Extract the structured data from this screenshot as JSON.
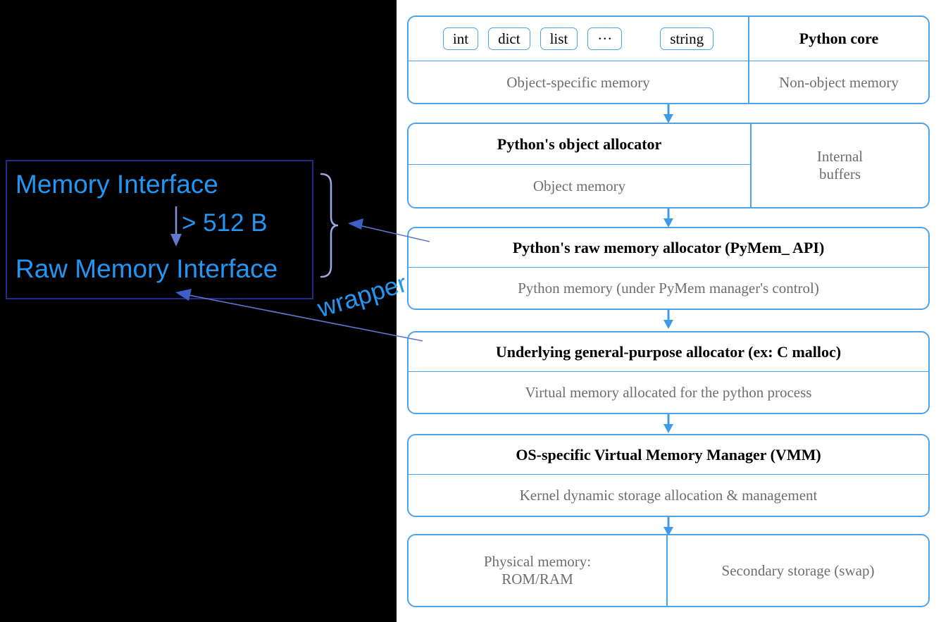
{
  "annotation": {
    "memory_interface_label": "Memory Interface",
    "raw_memory_interface_label": "Raw Memory Interface",
    "threshold_label": "> 512 B",
    "wrapper_label": "wrapper",
    "accent_color": "#2196f3",
    "panel_background": "#000000",
    "box_border_color": "#222a8c"
  },
  "diagram": {
    "accent_color": "#4da3e8",
    "title_color": "#000000",
    "subtitle_color": "#6e6e6e",
    "blocks": [
      {
        "id": "python-core",
        "title_left_types": [
          "int",
          "dict",
          "list",
          "···",
          "string"
        ],
        "title_right": "Python core",
        "sub_left": "Object-specific memory",
        "sub_right": "Non-object memory"
      },
      {
        "id": "object-allocator",
        "title_left": "Python's object allocator",
        "sub_left": "Object memory",
        "right_stacked": [
          "Internal",
          "buffers"
        ]
      },
      {
        "id": "raw-memory-allocator",
        "title": "Python's raw memory allocator (PyMem_ API)",
        "sub": "Python memory (under PyMem manager's control)"
      },
      {
        "id": "general-purpose-allocator",
        "title": "Underlying general-purpose allocator (ex: C malloc)",
        "sub": "Virtual memory allocated for the python process"
      },
      {
        "id": "virtual-memory-manager",
        "title": "OS-specific Virtual Memory Manager (VMM)",
        "sub": "Kernel dynamic storage allocation & management"
      },
      {
        "id": "physical-storage",
        "left_stacked": [
          "Physical memory:",
          "ROM/RAM"
        ],
        "right": "Secondary storage (swap)"
      }
    ]
  }
}
